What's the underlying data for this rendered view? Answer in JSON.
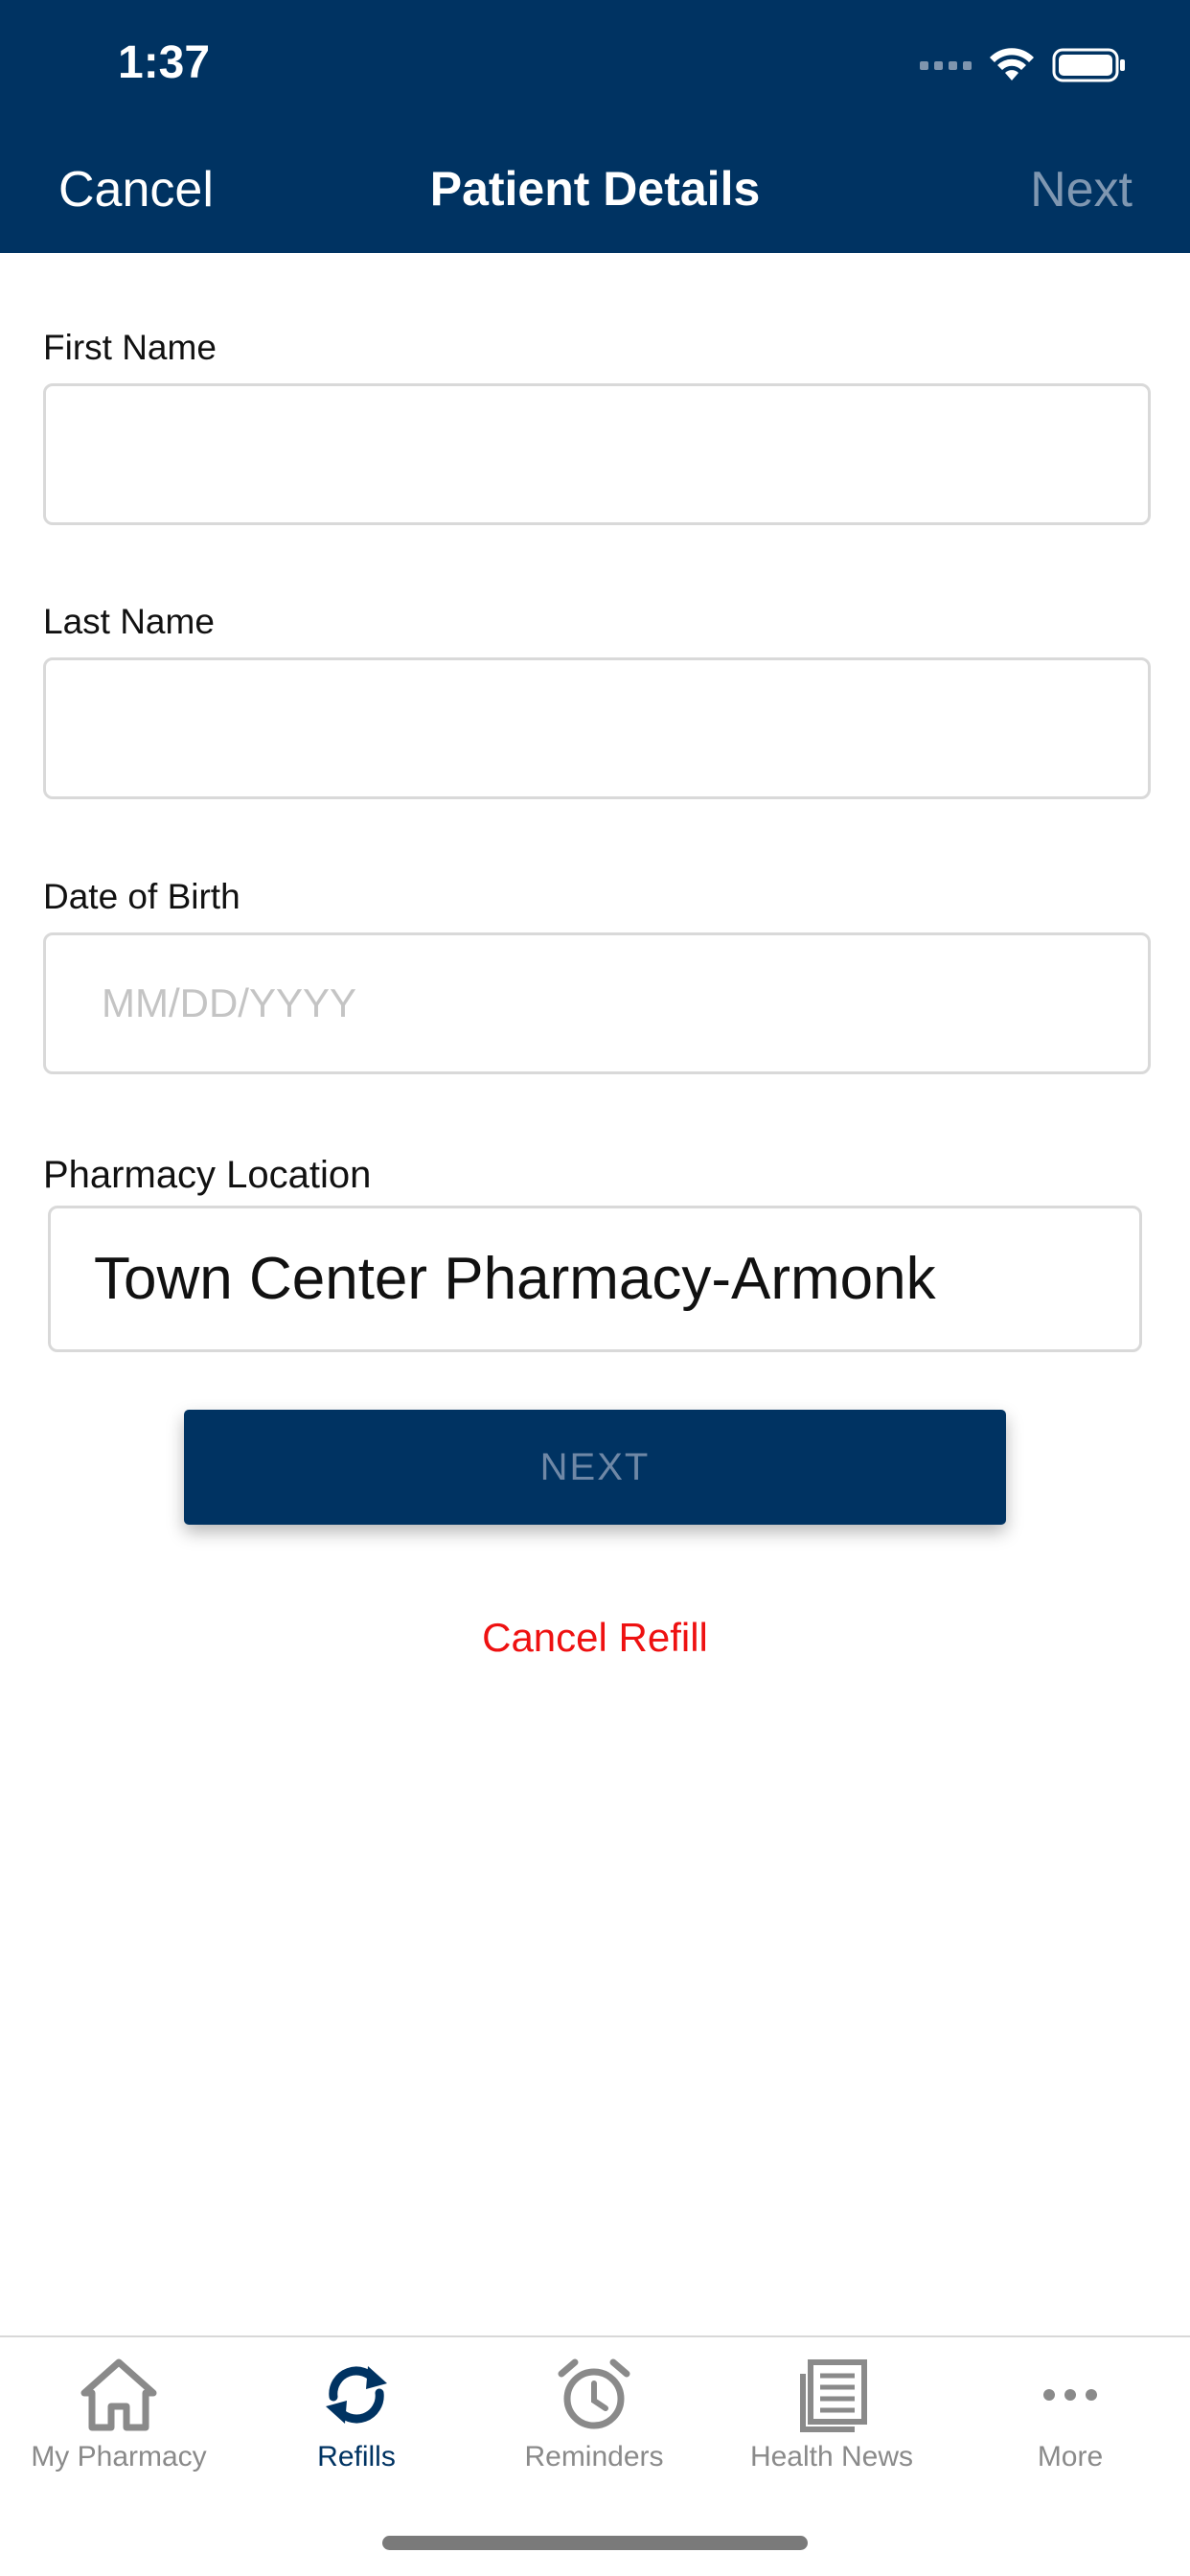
{
  "status_bar": {
    "time": "1:37"
  },
  "nav": {
    "cancel_label": "Cancel",
    "title": "Patient Details",
    "next_label": "Next"
  },
  "form": {
    "first_name": {
      "label": "First Name",
      "value": "",
      "placeholder": ""
    },
    "last_name": {
      "label": "Last Name",
      "value": "",
      "placeholder": ""
    },
    "date_of_birth": {
      "label": "Date of Birth",
      "value": "",
      "placeholder": "MM/DD/YYYY"
    },
    "pharmacy_location": {
      "label": "Pharmacy Location",
      "selected": "Town Center Pharmacy-Armonk"
    },
    "next_button_label": "NEXT",
    "cancel_refill_label": "Cancel Refill"
  },
  "tabbar": {
    "items": [
      {
        "label": "My Pharmacy",
        "icon": "home-icon",
        "active": false
      },
      {
        "label": "Refills",
        "icon": "refresh-icon",
        "active": true
      },
      {
        "label": "Reminders",
        "icon": "alarm-clock-icon",
        "active": false
      },
      {
        "label": "Health News",
        "icon": "newspaper-icon",
        "active": false
      },
      {
        "label": "More",
        "icon": "more-icon",
        "active": false
      }
    ]
  },
  "colors": {
    "brand_navy": "#003362",
    "nav_disabled": "#7f97b1",
    "destructive_red": "#ee1111",
    "tab_inactive": "#8a8a8a"
  }
}
